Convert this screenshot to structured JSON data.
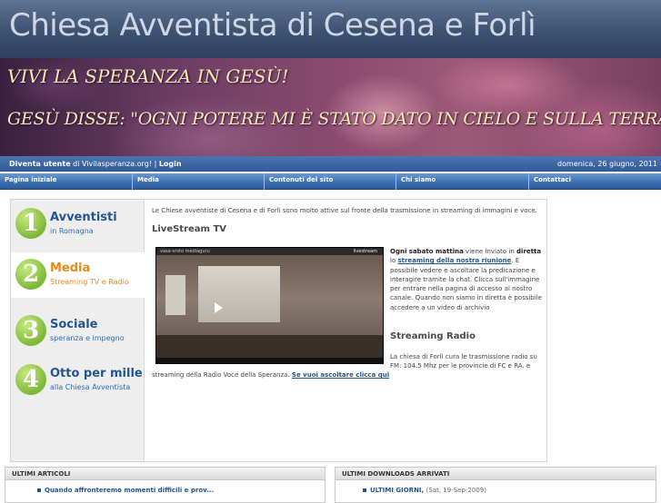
{
  "header": {
    "site_title": "Chiesa Avventista di Cesena e Forlì",
    "banner_line1": "Vivi la speranza in Gesù!",
    "banner_line2": "Gesù disse: \"Ogni potere mi è stato dato in cielo e sulla terra.\""
  },
  "user_bar": {
    "register_label": "Diventa utente",
    "register_suffix": "di Vivilasperanza.org!",
    "separator": "|",
    "login_label": "Login",
    "date": "domenica, 26 giugno, 2011"
  },
  "nav": {
    "items": [
      {
        "label": "Pagina iniziale"
      },
      {
        "label": "Media"
      },
      {
        "label": "Contenuti del sito"
      },
      {
        "label": "Chi siamo"
      },
      {
        "label": "Contattaci"
      }
    ]
  },
  "sidebar": {
    "items": [
      {
        "number": "1",
        "title": "Avventisti",
        "subtitle": "in Romagna"
      },
      {
        "number": "2",
        "title": "Media",
        "subtitle": "Streaming TV e Radio"
      },
      {
        "number": "3",
        "title": "Sociale",
        "subtitle": "speranza e impegno"
      },
      {
        "number": "4",
        "title": "Otto per mille",
        "subtitle": "alla Chiesa Avventista"
      }
    ]
  },
  "content": {
    "intro": "Le Chiese avventiste di Cesena e di Forlì sono molto attive sul fronte della trasmissione in streaming di immagini e voce.",
    "tv_heading": "LiveStream TV",
    "video_channel": "vasa-vrsto mediaguru",
    "video_brand": "livestream",
    "tv_p1_bold": "Ogni sabato mattina",
    "tv_p1_a": " viene inviato in ",
    "tv_p1_bold2": "diretta",
    "tv_p1_b": " lo ",
    "tv_p1_link": "streaming della nostra riunione",
    "tv_p1_c": ". È possibile vedere e ascoltare la predicazione e interagire tramite la chat. Clicca sull'immagine per entrare nella pagina di accesso al nostro canale. Quando non siamo in diretta è possibile accedere a un video di archivio",
    "radio_heading": "Streaming Radio",
    "radio_text": "La chiesa di Forlì cura le trasmissione radio su FM: 104.5 Mhz per le provincie di FC e RA. e",
    "radio_cont": "streaming della Radio Voce della Speranza.",
    "radio_link": "Se vuoi ascoltare clicca qui"
  },
  "bottom": {
    "articles_title": "ULTIMI ARTICOLI",
    "article_1": "Quando affronteremo momenti difficili e prov...",
    "downloads_title": "ULTIMI DOWNLOADS ARRIVATI",
    "download_1": "ULTIMI GIORNI",
    "download_1_date": "(Sat, 19-Sep-2009)"
  },
  "colors": {
    "accent_blue": "#23558f",
    "active_orange": "#e88a1a",
    "badge_green": "#7eb83a"
  }
}
